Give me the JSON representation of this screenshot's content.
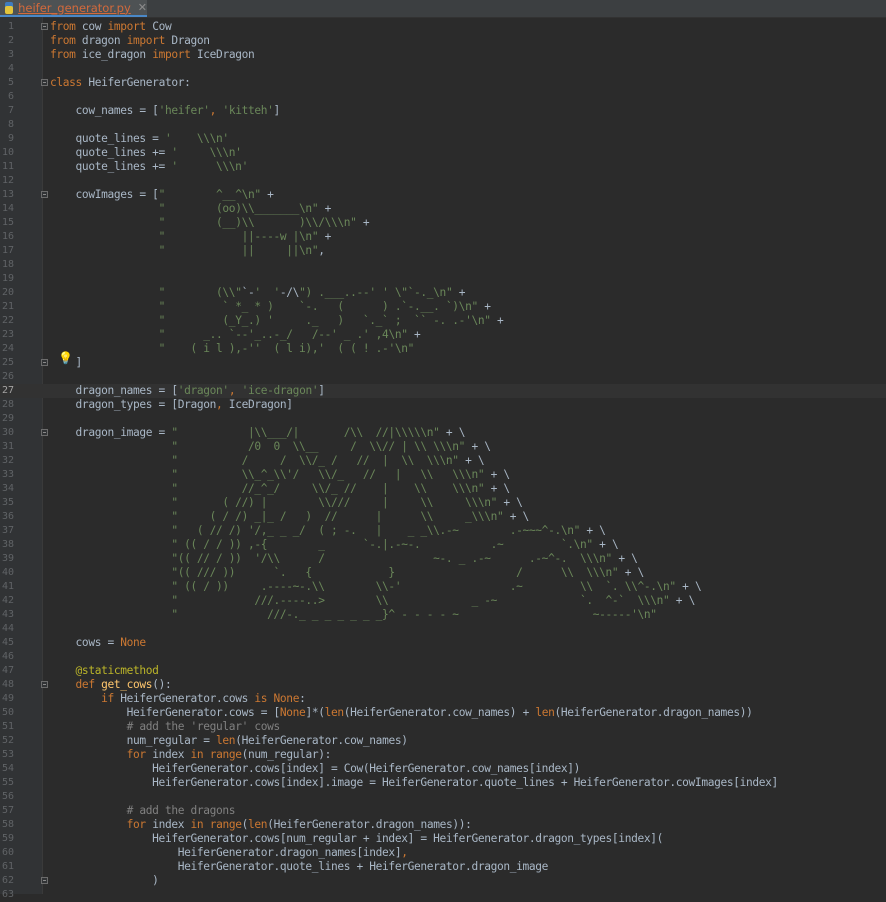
{
  "tab": {
    "filename": "heifer_generator.py",
    "close": "✕"
  },
  "current_line": 27,
  "lines": [
    "from cow import Cow",
    "from dragon import Dragon",
    "from ice_dragon import IceDragon",
    "",
    "class HeiferGenerator:",
    "",
    "    cow_names = ['heifer', 'kitteh']",
    "",
    "    quote_lines = '    \\\\\\n'",
    "    quote_lines += '     \\\\\\n'",
    "    quote_lines += '      \\\\\\n'",
    "",
    "    cowImages = [\"        ^__^\\n\" +",
    "                 \"        (oo)\\\\_______\\n\" +",
    "                 \"        (__)\\\\       )\\\\/\\\\\\n\" +",
    "                 \"            ||----w |\\n\" +",
    "                 \"            ||     ||\\n\",",
    "",
    "",
    "                 \"        (\\\\\"`-'  '-/\\\") .___..--' ' \\\"`-._\\n\" +",
    "                 \"         ` *_ * )    `-.   (      ) .`-.__. `)\\n\" +",
    "                 \"         (_Y_.) '     ._   )   `._` ;  `` -. .-'\\n\" +",
    "                 \"      _.. `--'_..-_/   /--' _ .' ,4\\n\" +",
    "                 \"    ( i l ),-''  ( l i),'  ( ( ! .-'\\n\"",
    "    ]",
    "",
    "    dragon_names = ['dragon', 'ice-dragon']",
    "    dragon_types = [Dragon, IceDragon]",
    "",
    "    dragon_image = \"           |\\\\___/|       /\\\\  //|\\\\\\\\\\n\" + \\",
    "                   \"           /0  0  \\\\__     /  \\\\// | \\\\ \\\\\\n\" + \\",
    "                   \"          /     /  \\\\/_ /   //  |  \\\\  \\\\\\n\" + \\",
    "                   \"          \\\\_^_\\\\'/   \\\\/_   //   |   \\\\   \\\\\\n\" + \\",
    "                   \"          //_^_/     \\\\/_ //    |    \\\\    \\\\\\n\" + \\",
    "                   \"       ( //) |        \\\\///     |     \\\\     \\\\\\n\" + \\",
    "                   \"     ( / /) _|_ /   )  //      |      \\\\     _\\\\\\n\" + \\",
    "                   \"   ( // /) '/,_ _ _/  ( ; -.   |    _ _\\\\.-~        .-~~~^-.\\n\" + \\",
    "                   \" (( / / )) ,-{        _      `-.|.-~-.           .~         `.\\n\" + \\",
    "                   \"(( // / ))  '/\\\\      /                 ~-. _ .-~      .-~^-.  \\\\\\n\" + \\",
    "                   \"(( /// ))      `.   {            }                   /      \\\\  \\\\\\n\" + \\",
    "                   \" (( / ))     .----~-.\\\\        \\\\-'                 .~         \\\\  `. \\\\^-.\\n\" + \\",
    "                   \"            ///.----..>        \\\\             _ -~             `.  ^-`  \\\\\\n\" + \\",
    "                   \"              ///-._ _ _ _ _ _ _}^ - - - - ~                     ~-----'\\n\"",
    "",
    "    cows = None",
    "",
    "    @staticmethod",
    "    def get_cows():",
    "        if HeiferGenerator.cows is None:",
    "            HeiferGenerator.cows = [None]*(len(HeiferGenerator.cow_names) + len(HeiferGenerator.dragon_names))",
    "            # add the 'regular' cows",
    "            num_regular = len(HeiferGenerator.cow_names)",
    "            for index in range(num_regular):",
    "                HeiferGenerator.cows[index] = Cow(HeiferGenerator.cow_names[index])",
    "                HeiferGenerator.cows[index].image = HeiferGenerator.quote_lines + HeiferGenerator.cowImages[index]",
    "",
    "            # add the dragons",
    "            for index in range(len(HeiferGenerator.dragon_names)):",
    "                HeiferGenerator.cows[num_regular + index] = HeiferGenerator.dragon_types[index](",
    "                    HeiferGenerator.dragon_names[index],",
    "                    HeiferGenerator.quote_lines + HeiferGenerator.dragon_image",
    "                )",
    ""
  ]
}
